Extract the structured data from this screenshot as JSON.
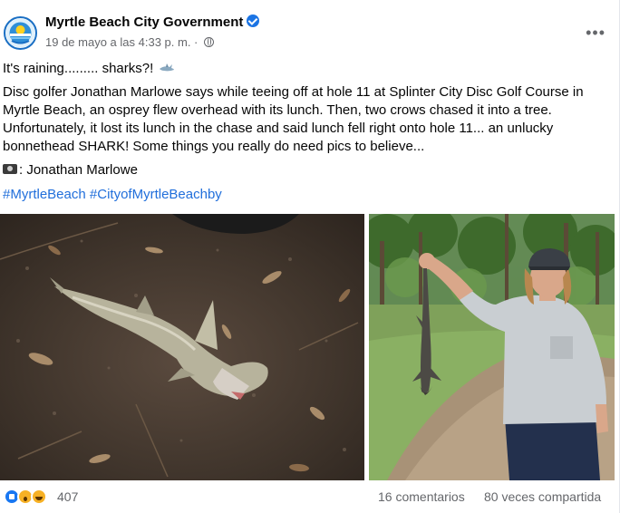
{
  "post": {
    "page_name": "Myrtle Beach City Government",
    "verified": true,
    "timestamp": "19 de mayo a las 4:33 p. m. ·",
    "more_label": "•••",
    "line1": "It's raining......... sharks?!",
    "body": "Disc golfer Jonathan Marlowe says while teeing off at hole 11 at Splinter City Disc Golf Course in Myrtle Beach, an osprey flew overhead with its lunch. Then, two crows chased it into a tree. Unfortunately, it lost its lunch in the chase and said lunch fell right onto hole 11... an unlucky bonnethead SHARK! Some things you really do need pics to believe...",
    "credit": ": Jonathan Marlowe",
    "hashtags": [
      "#MyrtleBeach",
      "#CityofMyrtleBeachby"
    ]
  },
  "photos": [
    {
      "subject": "bonnethead shark lying on dirt ground"
    },
    {
      "subject": "man holding bonnethead shark by the tail in a park"
    }
  ],
  "footer": {
    "reaction_count": "407",
    "comments": "16 comentarios",
    "shares": "80 veces compartida"
  },
  "icons": [
    "city-seal-icon",
    "verified-badge-icon",
    "globe-icon",
    "more-options-icon",
    "shark-emoji-icon",
    "camera-emoji-icon",
    "like-reaction-icon",
    "wow-reaction-icon",
    "haha-reaction-icon"
  ],
  "colors": {
    "link": "#216fdb",
    "muted": "#65676b",
    "like": "#1877f2",
    "verified": "#1b74e4"
  }
}
